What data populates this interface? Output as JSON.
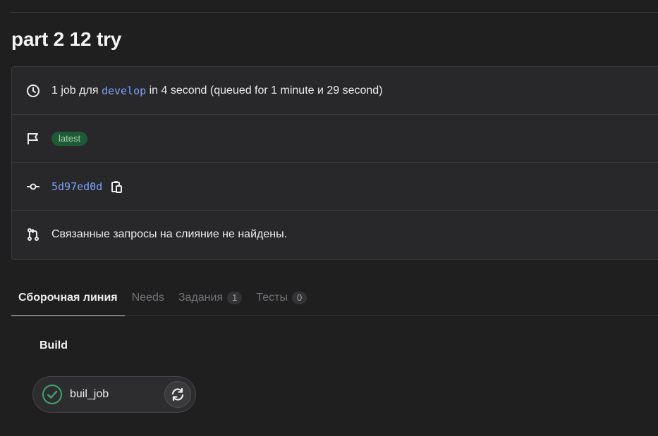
{
  "page": {
    "title": "part 2 12 try"
  },
  "info": {
    "jobs_prefix": "1 job для",
    "branch": "develop",
    "jobs_suffix": "in 4 second (queued for 1 minute и 29 second)",
    "badge": "latest",
    "sha": "5d97ed0d",
    "merge_requests": "Связанные запросы на слияние не найдены."
  },
  "tabs": [
    {
      "label": "Сборочная линия",
      "count": null
    },
    {
      "label": "Needs",
      "count": null
    },
    {
      "label": "Задания",
      "count": "1"
    },
    {
      "label": "Тесты",
      "count": "0"
    }
  ],
  "stage": {
    "title": "Build",
    "job": {
      "name": "buil_job",
      "status": "success"
    }
  },
  "colors": {
    "background": "#1f1f1f",
    "card": "#28282b",
    "link": "#7aa3ff",
    "success": "#3fa66b",
    "badge_bg": "#1f5a36"
  },
  "icons": [
    "clock-icon",
    "flag-icon",
    "commit-icon",
    "copy-icon",
    "merge-request-icon",
    "check-circle-icon",
    "retry-icon"
  ]
}
